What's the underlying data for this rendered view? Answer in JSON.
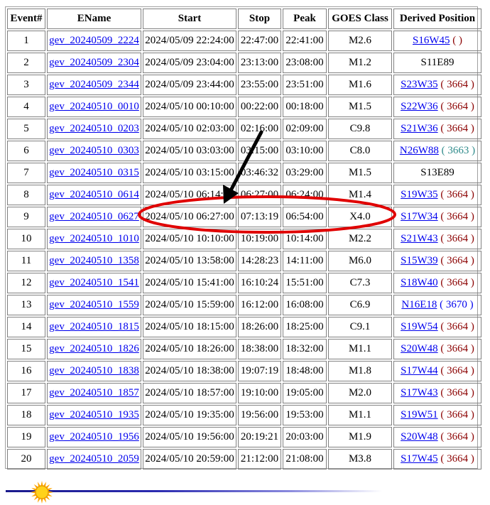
{
  "table": {
    "headers": [
      "Event#",
      "EName",
      "Start",
      "Stop",
      "Peak",
      "GOES Class",
      "Derived Position"
    ],
    "rows": [
      {
        "event": "1",
        "ename": "gev_20240509_2224",
        "start": "2024/05/09 22:24:00",
        "stop": "22:47:00",
        "peak": "22:41:00",
        "goes": "M2.6",
        "pos": "S16W45",
        "pos_link": true,
        "ar": "( )",
        "ar_style": "red"
      },
      {
        "event": "2",
        "ename": "gev_20240509_2304",
        "start": "2024/05/09 23:04:00",
        "stop": "23:13:00",
        "peak": "23:08:00",
        "goes": "M1.2",
        "pos": "S11E89",
        "pos_link": false,
        "ar": "",
        "ar_style": ""
      },
      {
        "event": "3",
        "ename": "gev_20240509_2344",
        "start": "2024/05/09 23:44:00",
        "stop": "23:55:00",
        "peak": "23:51:00",
        "goes": "M1.6",
        "pos": "S23W35",
        "pos_link": true,
        "ar": "( 3664 )",
        "ar_style": "red"
      },
      {
        "event": "4",
        "ename": "gev_20240510_0010",
        "start": "2024/05/10 00:10:00",
        "stop": "00:22:00",
        "peak": "00:18:00",
        "goes": "M1.5",
        "pos": "S22W36",
        "pos_link": true,
        "ar": "( 3664 )",
        "ar_style": "red"
      },
      {
        "event": "5",
        "ename": "gev_20240510_0203",
        "start": "2024/05/10 02:03:00",
        "stop": "02:16:00",
        "peak": "02:09:00",
        "goes": "C9.8",
        "pos": "S21W36",
        "pos_link": true,
        "ar": "( 3664 )",
        "ar_style": "red"
      },
      {
        "event": "6",
        "ename": "gev_20240510_0303",
        "start": "2024/05/10 03:03:00",
        "stop": "03:15:00",
        "peak": "03:10:00",
        "goes": "C8.0",
        "pos": "N26W88",
        "pos_link": true,
        "ar": "( 3663 )",
        "ar_style": "teal"
      },
      {
        "event": "7",
        "ename": "gev_20240510_0315",
        "start": "2024/05/10 03:15:00",
        "stop": "03:46:32",
        "peak": "03:29:00",
        "goes": "M1.5",
        "pos": "S13E89",
        "pos_link": false,
        "ar": "",
        "ar_style": ""
      },
      {
        "event": "8",
        "ename": "gev_20240510_0614",
        "start": "2024/05/10 06:14:00",
        "stop": "06:27:00",
        "peak": "06:24:00",
        "goes": "M1.4",
        "pos": "S19W35",
        "pos_link": true,
        "ar": "( 3664 )",
        "ar_style": "red"
      },
      {
        "event": "9",
        "ename": "gev_20240510_0627",
        "start": "2024/05/10 06:27:00",
        "stop": "07:13:19",
        "peak": "06:54:00",
        "goes": "X4.0",
        "pos": "S17W34",
        "pos_link": true,
        "ar": "( 3664 )",
        "ar_style": "red"
      },
      {
        "event": "10",
        "ename": "gev_20240510_1010",
        "start": "2024/05/10 10:10:00",
        "stop": "10:19:00",
        "peak": "10:14:00",
        "goes": "M2.2",
        "pos": "S21W43",
        "pos_link": true,
        "ar": "( 3664 )",
        "ar_style": "red"
      },
      {
        "event": "11",
        "ename": "gev_20240510_1358",
        "start": "2024/05/10 13:58:00",
        "stop": "14:28:23",
        "peak": "14:11:00",
        "goes": "M6.0",
        "pos": "S15W39",
        "pos_link": true,
        "ar": "( 3664 )",
        "ar_style": "red"
      },
      {
        "event": "12",
        "ename": "gev_20240510_1541",
        "start": "2024/05/10 15:41:00",
        "stop": "16:10:24",
        "peak": "15:51:00",
        "goes": "C7.3",
        "pos": "S18W40",
        "pos_link": true,
        "ar": "( 3664 )",
        "ar_style": "red"
      },
      {
        "event": "13",
        "ename": "gev_20240510_1559",
        "start": "2024/05/10 15:59:00",
        "stop": "16:12:00",
        "peak": "16:08:00",
        "goes": "C6.9",
        "pos": "N16E18",
        "pos_link": true,
        "ar": "( 3670 )",
        "ar_style": "blue"
      },
      {
        "event": "14",
        "ename": "gev_20240510_1815",
        "start": "2024/05/10 18:15:00",
        "stop": "18:26:00",
        "peak": "18:25:00",
        "goes": "C9.1",
        "pos": "S19W54",
        "pos_link": true,
        "ar": "( 3664 )",
        "ar_style": "red"
      },
      {
        "event": "15",
        "ename": "gev_20240510_1826",
        "start": "2024/05/10 18:26:00",
        "stop": "18:38:00",
        "peak": "18:32:00",
        "goes": "M1.1",
        "pos": "S20W48",
        "pos_link": true,
        "ar": "( 3664 )",
        "ar_style": "red"
      },
      {
        "event": "16",
        "ename": "gev_20240510_1838",
        "start": "2024/05/10 18:38:00",
        "stop": "19:07:19",
        "peak": "18:48:00",
        "goes": "M1.8",
        "pos": "S17W44",
        "pos_link": true,
        "ar": "( 3664 )",
        "ar_style": "red"
      },
      {
        "event": "17",
        "ename": "gev_20240510_1857",
        "start": "2024/05/10 18:57:00",
        "stop": "19:10:00",
        "peak": "19:05:00",
        "goes": "M2.0",
        "pos": "S17W43",
        "pos_link": true,
        "ar": "( 3664 )",
        "ar_style": "red"
      },
      {
        "event": "18",
        "ename": "gev_20240510_1935",
        "start": "2024/05/10 19:35:00",
        "stop": "19:56:00",
        "peak": "19:53:00",
        "goes": "M1.1",
        "pos": "S19W51",
        "pos_link": true,
        "ar": "( 3664 )",
        "ar_style": "red"
      },
      {
        "event": "19",
        "ename": "gev_20240510_1956",
        "start": "2024/05/10 19:56:00",
        "stop": "20:19:21",
        "peak": "20:03:00",
        "goes": "M1.9",
        "pos": "S20W48",
        "pos_link": true,
        "ar": "( 3664 )",
        "ar_style": "red"
      },
      {
        "event": "20",
        "ename": "gev_20240510_2059",
        "start": "2024/05/10 20:59:00",
        "stop": "21:12:00",
        "peak": "21:08:00",
        "goes": "M3.8",
        "pos": "S17W45",
        "pos_link": true,
        "ar": "( 3664 )",
        "ar_style": "red"
      }
    ]
  },
  "annotations": {
    "highlight_row_event": "9",
    "ellipse_color": "#e00000",
    "arrow_color": "#000000"
  },
  "colors": {
    "link": "#0000ee",
    "ar_red": "#8b0000",
    "ar_teal": "#2e8b8b",
    "ar_blue": "#0000ee",
    "footer_line": "#1a1a8c",
    "sun": "#ffcc00"
  },
  "icons": {
    "footer_icon": "sun-icon"
  }
}
